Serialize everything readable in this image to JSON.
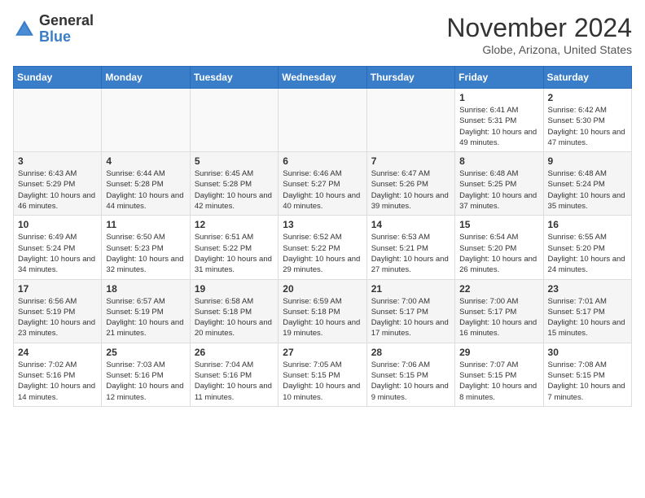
{
  "header": {
    "logo_general": "General",
    "logo_blue": "Blue",
    "month_title": "November 2024",
    "location": "Globe, Arizona, United States"
  },
  "weekdays": [
    "Sunday",
    "Monday",
    "Tuesday",
    "Wednesday",
    "Thursday",
    "Friday",
    "Saturday"
  ],
  "weeks": [
    [
      {
        "day": "",
        "empty": true
      },
      {
        "day": "",
        "empty": true
      },
      {
        "day": "",
        "empty": true
      },
      {
        "day": "",
        "empty": true
      },
      {
        "day": "",
        "empty": true
      },
      {
        "day": "1",
        "sunrise": "6:41 AM",
        "sunset": "5:31 PM",
        "daylight": "10 hours and 49 minutes."
      },
      {
        "day": "2",
        "sunrise": "6:42 AM",
        "sunset": "5:30 PM",
        "daylight": "10 hours and 47 minutes."
      }
    ],
    [
      {
        "day": "3",
        "sunrise": "6:43 AM",
        "sunset": "5:29 PM",
        "daylight": "10 hours and 46 minutes."
      },
      {
        "day": "4",
        "sunrise": "6:44 AM",
        "sunset": "5:28 PM",
        "daylight": "10 hours and 44 minutes."
      },
      {
        "day": "5",
        "sunrise": "6:45 AM",
        "sunset": "5:28 PM",
        "daylight": "10 hours and 42 minutes."
      },
      {
        "day": "6",
        "sunrise": "6:46 AM",
        "sunset": "5:27 PM",
        "daylight": "10 hours and 40 minutes."
      },
      {
        "day": "7",
        "sunrise": "6:47 AM",
        "sunset": "5:26 PM",
        "daylight": "10 hours and 39 minutes."
      },
      {
        "day": "8",
        "sunrise": "6:48 AM",
        "sunset": "5:25 PM",
        "daylight": "10 hours and 37 minutes."
      },
      {
        "day": "9",
        "sunrise": "6:48 AM",
        "sunset": "5:24 PM",
        "daylight": "10 hours and 35 minutes."
      }
    ],
    [
      {
        "day": "10",
        "sunrise": "6:49 AM",
        "sunset": "5:24 PM",
        "daylight": "10 hours and 34 minutes."
      },
      {
        "day": "11",
        "sunrise": "6:50 AM",
        "sunset": "5:23 PM",
        "daylight": "10 hours and 32 minutes."
      },
      {
        "day": "12",
        "sunrise": "6:51 AM",
        "sunset": "5:22 PM",
        "daylight": "10 hours and 31 minutes."
      },
      {
        "day": "13",
        "sunrise": "6:52 AM",
        "sunset": "5:22 PM",
        "daylight": "10 hours and 29 minutes."
      },
      {
        "day": "14",
        "sunrise": "6:53 AM",
        "sunset": "5:21 PM",
        "daylight": "10 hours and 27 minutes."
      },
      {
        "day": "15",
        "sunrise": "6:54 AM",
        "sunset": "5:20 PM",
        "daylight": "10 hours and 26 minutes."
      },
      {
        "day": "16",
        "sunrise": "6:55 AM",
        "sunset": "5:20 PM",
        "daylight": "10 hours and 24 minutes."
      }
    ],
    [
      {
        "day": "17",
        "sunrise": "6:56 AM",
        "sunset": "5:19 PM",
        "daylight": "10 hours and 23 minutes."
      },
      {
        "day": "18",
        "sunrise": "6:57 AM",
        "sunset": "5:19 PM",
        "daylight": "10 hours and 21 minutes."
      },
      {
        "day": "19",
        "sunrise": "6:58 AM",
        "sunset": "5:18 PM",
        "daylight": "10 hours and 20 minutes."
      },
      {
        "day": "20",
        "sunrise": "6:59 AM",
        "sunset": "5:18 PM",
        "daylight": "10 hours and 19 minutes."
      },
      {
        "day": "21",
        "sunrise": "7:00 AM",
        "sunset": "5:17 PM",
        "daylight": "10 hours and 17 minutes."
      },
      {
        "day": "22",
        "sunrise": "7:00 AM",
        "sunset": "5:17 PM",
        "daylight": "10 hours and 16 minutes."
      },
      {
        "day": "23",
        "sunrise": "7:01 AM",
        "sunset": "5:17 PM",
        "daylight": "10 hours and 15 minutes."
      }
    ],
    [
      {
        "day": "24",
        "sunrise": "7:02 AM",
        "sunset": "5:16 PM",
        "daylight": "10 hours and 14 minutes."
      },
      {
        "day": "25",
        "sunrise": "7:03 AM",
        "sunset": "5:16 PM",
        "daylight": "10 hours and 12 minutes."
      },
      {
        "day": "26",
        "sunrise": "7:04 AM",
        "sunset": "5:16 PM",
        "daylight": "10 hours and 11 minutes."
      },
      {
        "day": "27",
        "sunrise": "7:05 AM",
        "sunset": "5:15 PM",
        "daylight": "10 hours and 10 minutes."
      },
      {
        "day": "28",
        "sunrise": "7:06 AM",
        "sunset": "5:15 PM",
        "daylight": "10 hours and 9 minutes."
      },
      {
        "day": "29",
        "sunrise": "7:07 AM",
        "sunset": "5:15 PM",
        "daylight": "10 hours and 8 minutes."
      },
      {
        "day": "30",
        "sunrise": "7:08 AM",
        "sunset": "5:15 PM",
        "daylight": "10 hours and 7 minutes."
      }
    ]
  ]
}
